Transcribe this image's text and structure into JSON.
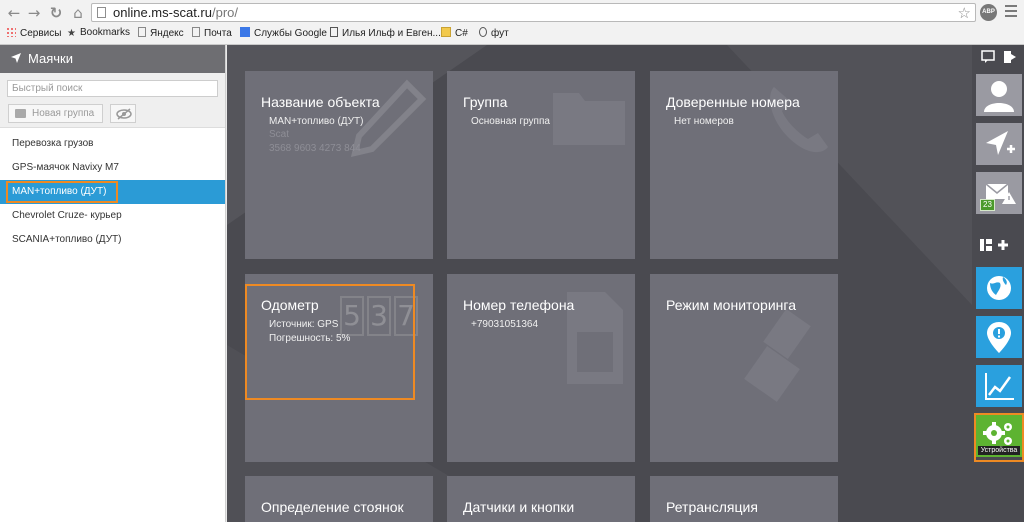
{
  "browser": {
    "url_host": "online.ms-scat.ru",
    "url_path": "/pro/",
    "bookmarks": [
      {
        "label": "Сервисы",
        "icon": "apps-icon"
      },
      {
        "label": "Bookmarks",
        "icon": "star-icon"
      },
      {
        "label": "Яндекс",
        "icon": "page-icon"
      },
      {
        "label": "Почта",
        "icon": "page-icon"
      },
      {
        "label": "Службы Google",
        "icon": "google-icon"
      },
      {
        "label": "Илья Ильф и Евген...",
        "icon": "site-icon"
      },
      {
        "label": "C#",
        "icon": "folder-icon"
      },
      {
        "label": "фут",
        "icon": "site-icon"
      }
    ],
    "abp_label": "ABP"
  },
  "sidebar": {
    "title": "Маячки",
    "search_placeholder": "Быстрый поиск",
    "new_group_label": "Новая группа",
    "items": [
      {
        "label": "Перевозка грузов"
      },
      {
        "label": "GPS-маячок Navixy M7"
      },
      {
        "label": "MAN+топливо (ДУТ)"
      },
      {
        "label": "Chevrolet Cruze- курьер"
      },
      {
        "label": "SCANIA+топливо (ДУТ)"
      }
    ],
    "active_index": 2
  },
  "tiles": {
    "name": {
      "title": "Название объекта",
      "line1": "MAN+топливо (ДУТ)",
      "line2": "Scat",
      "line3": "3568 9603 4273 844"
    },
    "group": {
      "title": "Группа",
      "line1": "Основная группа"
    },
    "trusted": {
      "title": "Доверенные номера",
      "line1": "Нет номеров"
    },
    "odometer": {
      "title": "Одометр",
      "line1": "Источник: GPS",
      "line2": "Погрешность: 5%",
      "watermark_digits": "537"
    },
    "phone": {
      "title": "Номер телефона",
      "line1": "+79031051364"
    },
    "monitoring": {
      "title": "Режим мониторинга"
    },
    "parking": {
      "title": "Определение стоянок"
    },
    "sensors": {
      "title": "Датчики и кнопки"
    },
    "relay": {
      "title": "Ретрансляция"
    }
  },
  "toolbar": {
    "messages_badge": "23",
    "devices_label": "Устройства"
  }
}
